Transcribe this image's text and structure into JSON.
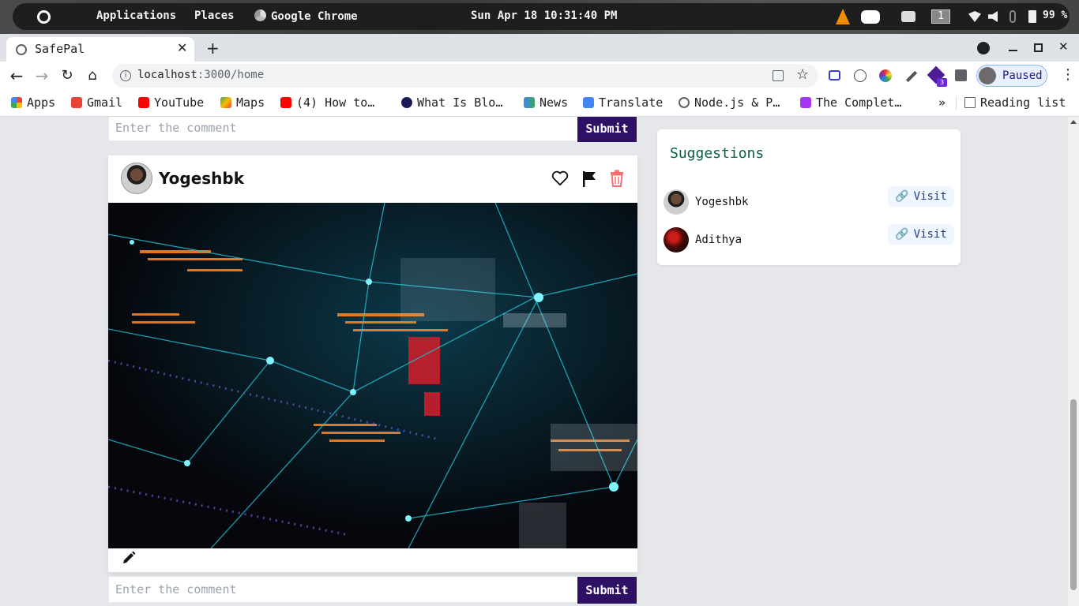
{
  "system_bar": {
    "applications": "Applications",
    "places": "Places",
    "active_app": "Google Chrome",
    "datetime": "Sun Apr 18 10:31:40 PM",
    "workspace": "1",
    "battery": "99 %"
  },
  "browser": {
    "tab_title": "SafePal",
    "url_host": "localhost",
    "url_rest": ":3000/home",
    "profile_status": "Paused",
    "extension_badge": "3",
    "bookmarks": [
      {
        "label": "Apps",
        "icon": "apps-grid-icon"
      },
      {
        "label": "Gmail",
        "icon": "gmail-icon"
      },
      {
        "label": "YouTube",
        "icon": "youtube-icon"
      },
      {
        "label": "Maps",
        "icon": "maps-icon"
      },
      {
        "label": "(4) How to…",
        "icon": "youtube-icon"
      },
      {
        "label": "What Is Blo…",
        "icon": "b-logo-icon"
      },
      {
        "label": "News",
        "icon": "news-icon"
      },
      {
        "label": "Translate",
        "icon": "translate-icon"
      },
      {
        "label": "Node.js & P…",
        "icon": "globe-icon"
      },
      {
        "label": "The Complet…",
        "icon": "udemy-icon"
      }
    ],
    "overflow": "»",
    "reading_list": "Reading list"
  },
  "feed": {
    "comment_placeholder": "Enter the comment",
    "submit_label": "Submit",
    "post": {
      "username": "Yogeshbk"
    }
  },
  "suggestions": {
    "title": "Suggestions",
    "items": [
      {
        "name": "Yogeshbk",
        "action": "Visit"
      },
      {
        "name": "Adithya",
        "action": "Visit"
      }
    ]
  },
  "colors": {
    "submit_bg": "#2e1065",
    "suggest_title": "#065f46",
    "visit_text": "#1e3a8a",
    "delete_icon": "#f87171"
  }
}
